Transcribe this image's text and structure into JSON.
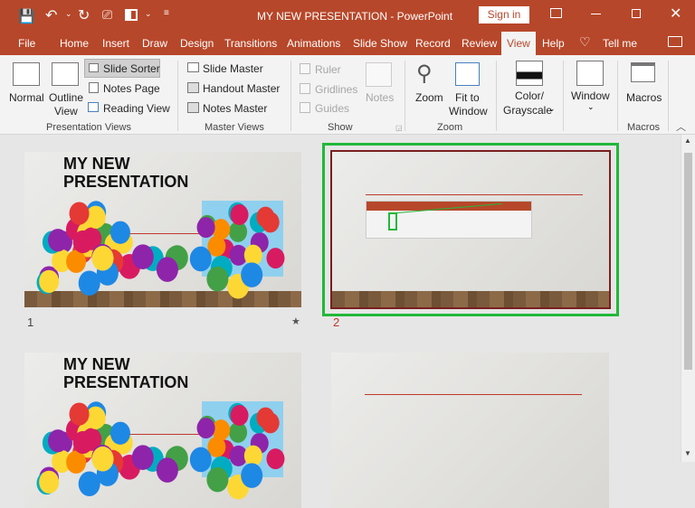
{
  "titlebar": {
    "title": "MY NEW PRESENTATION  -  PowerPoint",
    "sign_in": "Sign in"
  },
  "tabs": [
    "File",
    "Home",
    "Insert",
    "Draw",
    "Design",
    "Transitions",
    "Animations",
    "Slide Show",
    "Record",
    "Review",
    "View",
    "Help"
  ],
  "active_tab": "View",
  "tell_me": "Tell me",
  "ribbon": {
    "presentation_views": {
      "normal": "Normal",
      "outline": "Outline",
      "outline2": "View",
      "slide_sorter": "Slide Sorter",
      "notes_page": "Notes Page",
      "reading_view": "Reading View",
      "label": "Presentation Views"
    },
    "master_views": {
      "slide_master": "Slide Master",
      "handout_master": "Handout Master",
      "notes_master": "Notes Master",
      "label": "Master Views"
    },
    "show": {
      "ruler": "Ruler",
      "gridlines": "Gridlines",
      "guides": "Guides",
      "notes": "Notes",
      "label": "Show"
    },
    "zoom": {
      "zoom": "Zoom",
      "fit1": "Fit to",
      "fit2": "Window",
      "label": "Zoom"
    },
    "color": {
      "l1": "Color/",
      "l2": "Grayscale"
    },
    "window": {
      "label": "Window"
    },
    "macros": {
      "macros": "Macros",
      "label": "Macros"
    }
  },
  "slides": [
    {
      "number": "1",
      "title1": "MY NEW",
      "title2": "PRESENTATION",
      "has_star": true,
      "star": "★"
    },
    {
      "number": "2",
      "selected": true
    },
    {
      "title1": "MY NEW",
      "title2": "PRESENTATION"
    },
    {}
  ],
  "colors": {
    "accent": "#b7472a",
    "selection": "#22b83a"
  }
}
